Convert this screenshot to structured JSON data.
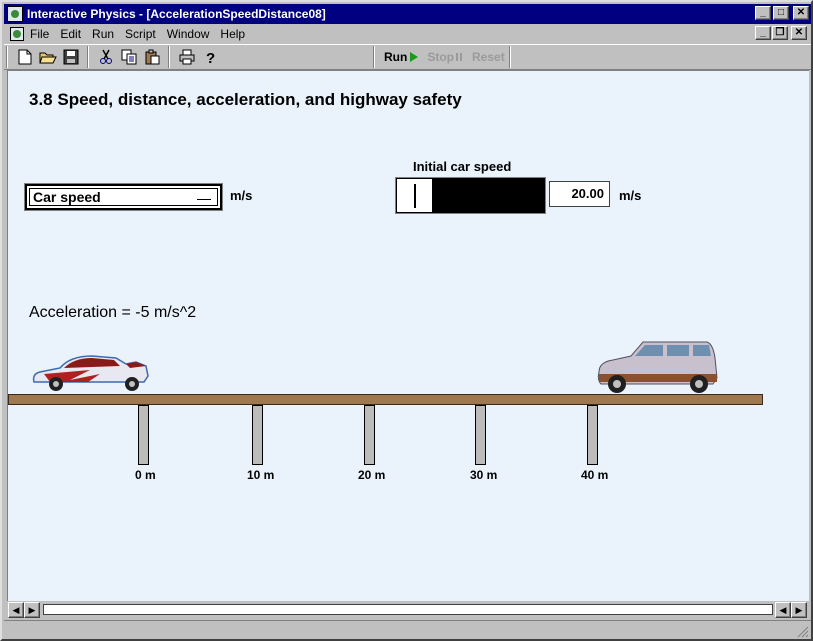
{
  "window": {
    "title": "Interactive Physics - [AccelerationSpeedDistance08]",
    "caption_buttons": {
      "minimize": "_",
      "maximize": "□",
      "close": "✕"
    },
    "mdi_buttons": {
      "minimize": "_",
      "restore": "❐",
      "close": "✕"
    }
  },
  "menu": [
    "File",
    "Edit",
    "Run",
    "Script",
    "Window",
    "Help"
  ],
  "toolbar": {
    "icons": [
      "new-file-icon",
      "open-folder-icon",
      "save-icon",
      "cut-icon",
      "copy-icon",
      "paste-icon",
      "print-icon",
      "help-icon"
    ],
    "run_label": "Run",
    "stop_label": "Stop",
    "reset_label": "Reset"
  },
  "workspace": {
    "title": "3.8 Speed, distance, acceleration, and highway safety",
    "meter": {
      "label": "Car speed",
      "unit": "m/s"
    },
    "slider": {
      "label": "Initial car speed",
      "value": "20.00",
      "unit": "m/s"
    },
    "acceleration_text": "Acceleration = -5 m/s^2",
    "distance_marks": [
      "0 m",
      "10 m",
      "20 m",
      "30 m",
      "40 m"
    ]
  },
  "colors": {
    "titlebar": "#000080",
    "workspace_bg": "#eaf2fb",
    "road": "#a07850",
    "run_green": "#1a9a1a"
  }
}
